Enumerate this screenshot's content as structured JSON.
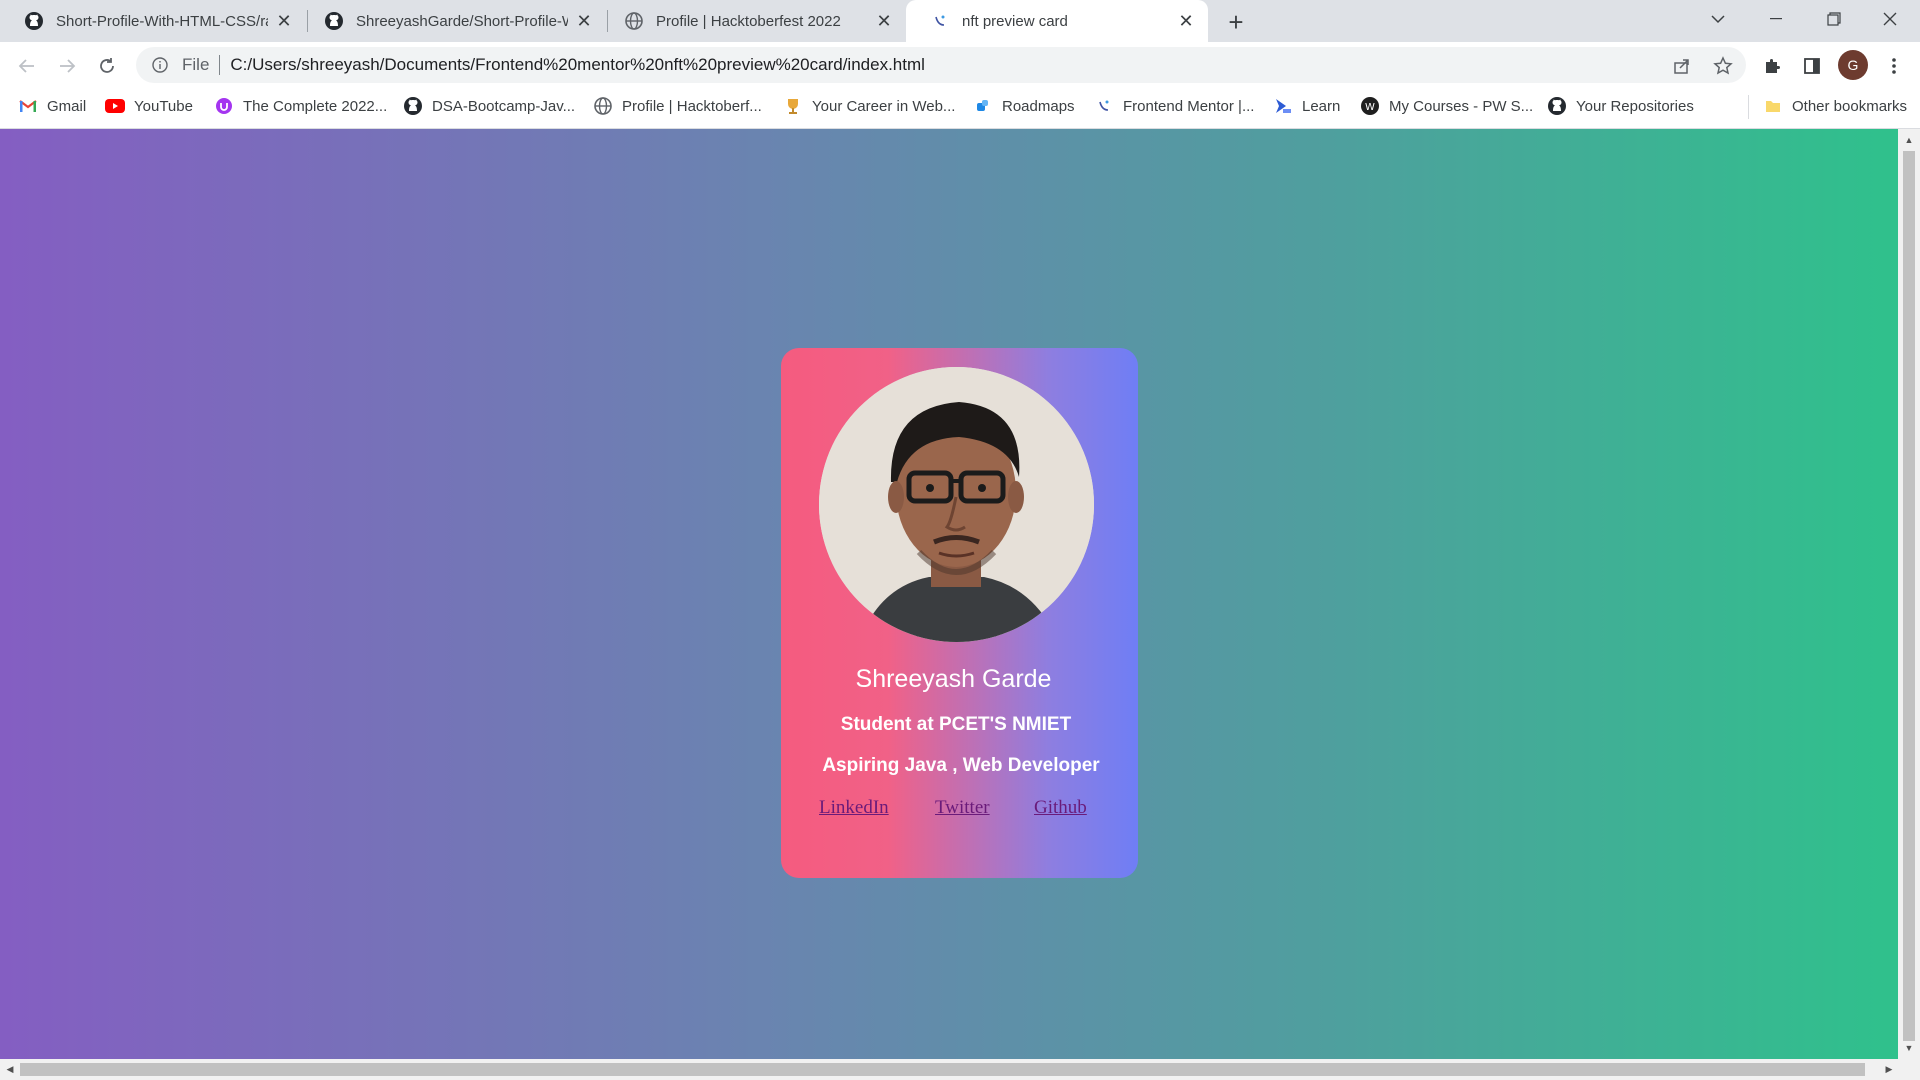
{
  "browser": {
    "tabs": [
      {
        "title": "Short-Profile-With-HTML-CSS/ra",
        "icon": "github-icon"
      },
      {
        "title": "ShreeyashGarde/Short-Profile-W",
        "icon": "github-icon"
      },
      {
        "title": "Profile | Hacktoberfest 2022",
        "icon": "globe-icon"
      },
      {
        "title": "nft preview card",
        "icon": "frontend-mentor-icon",
        "active": true
      }
    ],
    "address": {
      "scheme": "File",
      "url": "C:/Users/shreeyash/Documents/Frontend%20mentor%20nft%20preview%20card/index.html"
    },
    "profile_initial": "G",
    "bookmarks": [
      {
        "label": "Gmail",
        "icon": "gmail-icon"
      },
      {
        "label": "YouTube",
        "icon": "youtube-icon"
      },
      {
        "label": "The Complete 2022...",
        "icon": "udemy-icon"
      },
      {
        "label": "DSA-Bootcamp-Jav...",
        "icon": "github-icon"
      },
      {
        "label": "Profile | Hacktoberf...",
        "icon": "globe-icon"
      },
      {
        "label": "Your Career in Web...",
        "icon": "trophy-icon"
      },
      {
        "label": "Roadmaps",
        "icon": "roadmap-icon"
      },
      {
        "label": "Frontend Mentor |...",
        "icon": "frontend-mentor-icon"
      },
      {
        "label": "Learn",
        "icon": "learn-icon"
      },
      {
        "label": "My Courses - PW S...",
        "icon": "pw-icon"
      },
      {
        "label": "Your Repositories",
        "icon": "github-icon"
      }
    ],
    "other_bookmarks": "Other bookmarks"
  },
  "page": {
    "name": "Shreeyash Garde",
    "line1": "Student at PCET'S NMIET",
    "line2": "Aspiring Java , Web Developer",
    "links": {
      "linkedin": "LinkedIn",
      "twitter": "Twitter",
      "github": "Github"
    },
    "colors": {
      "background_start": "#845ec2",
      "background_end": "#2fc18c",
      "card_left": "#f55b7f",
      "card_right": "#6f7ef5",
      "link": "#6a1b7a"
    }
  }
}
